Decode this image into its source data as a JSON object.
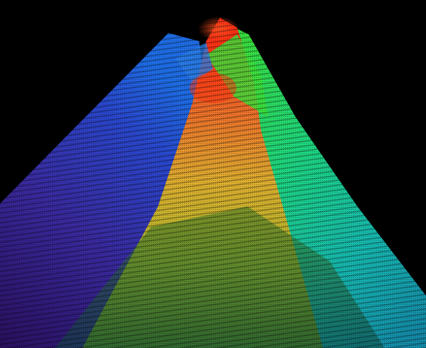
{
  "scene": {
    "subject": "",
    "background_color": "#000000",
    "colormap": [
      "#3a1a8a",
      "#2a3cc8",
      "#1e9ee0",
      "#16d6a0",
      "#3ee05a",
      "#b8d838",
      "#f0b030",
      "#ff6a1e",
      "#ff2a10"
    ]
  }
}
